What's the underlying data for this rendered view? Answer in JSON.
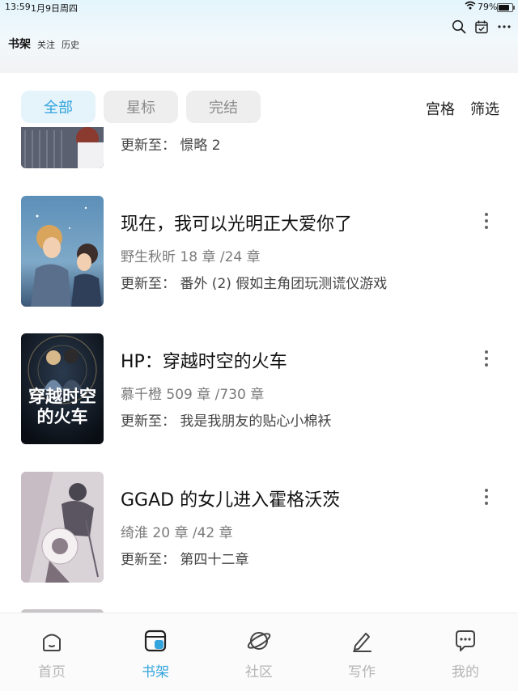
{
  "status_bar": {
    "time": "13:59",
    "date": "1月9日周四",
    "battery": "79%",
    "battery_level": 0.79
  },
  "header": {
    "tabs": [
      {
        "label": "书架",
        "active": true
      },
      {
        "label": "关注",
        "active": false
      },
      {
        "label": "历史",
        "active": false
      }
    ],
    "icons": [
      "search-icon",
      "calendar-check-icon",
      "more-horizontal-icon"
    ]
  },
  "filters": {
    "chips": [
      {
        "label": "全部",
        "active": true
      },
      {
        "label": "星标",
        "active": false
      },
      {
        "label": "完结",
        "active": false
      }
    ],
    "grid_label": "宫格",
    "filter_label": "筛选"
  },
  "books": [
    {
      "title": "",
      "author": "",
      "chapters": "",
      "update": "更新至：  憬略 2"
    },
    {
      "title": "现在，我可以光明正大爱你了",
      "author": "野生秋昕",
      "chapters": "18 章 /24 章",
      "update": "更新至：  番外 (2) 假如主角团玩测谎仪游戏"
    },
    {
      "title": "HP：穿越时空的火车",
      "author": "慕千橙",
      "chapters": "509 章 /730 章",
      "update": "更新至：  我是我朋友的贴心小棉袄",
      "cover_text": "穿越时空的火车"
    },
    {
      "title": "GGAD 的女儿进入霍格沃茨",
      "author": "绮淮",
      "chapters": "20 章 /42 章",
      "update": "更新至：  第四十二章"
    }
  ],
  "bottom_nav": [
    {
      "label": "首页",
      "icon": "home-icon",
      "active": false
    },
    {
      "label": "书架",
      "icon": "bookshelf-icon",
      "active": true
    },
    {
      "label": "社区",
      "icon": "planet-icon",
      "active": false
    },
    {
      "label": "写作",
      "icon": "pen-icon",
      "active": false
    },
    {
      "label": "我的",
      "icon": "chat-bubble-icon",
      "active": false
    }
  ],
  "colors": {
    "accent": "#34a4dc",
    "chip_bg": "#eeeeef",
    "chip_active_bg": "#e5f3fb"
  }
}
